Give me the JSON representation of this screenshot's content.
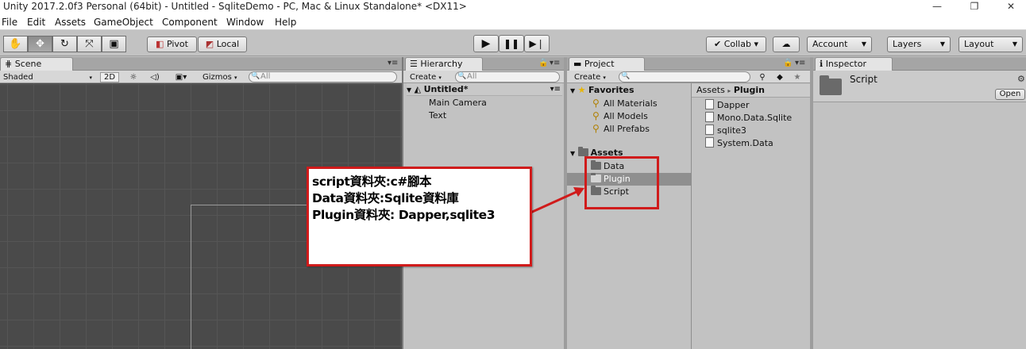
{
  "window": {
    "title": "Unity 2017.2.0f3 Personal (64bit) - Untitled - SqliteDemo - PC, Mac & Linux Standalone* <DX11>",
    "minimize": "—",
    "maximize": "❐",
    "close": "✕"
  },
  "menu": [
    "File",
    "Edit",
    "Assets",
    "GameObject",
    "Component",
    "Window",
    "Help"
  ],
  "toolbar": {
    "tools": [
      "hand-tool",
      "move-tool",
      "rotate-tool",
      "scale-tool",
      "rect-tool"
    ],
    "pivot_label": "Pivot",
    "local_label": "Local",
    "play_icon": "▶",
    "pause_icon": "❚❚",
    "step_icon": "▶❘",
    "collab_label": "Collab ▾",
    "cloud_icon": "☁",
    "account_label": "Account",
    "layers_label": "Layers",
    "layout_label": "Layout"
  },
  "scene": {
    "tab_label": "Scene",
    "shading": "Shaded",
    "mode_2d": "2D",
    "gizmos": "Gizmos",
    "search_placeholder": "All"
  },
  "hierarchy": {
    "tab_label": "Hierarchy",
    "create_label": "Create",
    "search_placeholder": "All",
    "scene_name": "Untitled*",
    "items": [
      "Main Camera",
      "Text"
    ]
  },
  "project": {
    "tab_label": "Project",
    "create_label": "Create",
    "favorites_label": "Favorites",
    "favorites": [
      "All Materials",
      "All Models",
      "All Prefabs"
    ],
    "assets_label": "Assets",
    "folders": [
      "Data",
      "Plugin",
      "Script"
    ],
    "selected_folder": "Plugin",
    "breadcrumb_root": "Assets",
    "breadcrumb_sep": "▸",
    "breadcrumb_current": "Plugin",
    "files": [
      "Dapper",
      "Mono.Data.Sqlite",
      "sqlite3",
      "System.Data"
    ]
  },
  "inspector": {
    "tab_label": "Inspector",
    "object_name": "Script",
    "open_label": "Open"
  },
  "annotation": {
    "lines": [
      "script資料夾:c#腳本",
      "Data資料夾:Sqlite資料庫",
      "Plugin資料夾: Dapper,sqlite3"
    ],
    "color": "#d01b1b"
  }
}
